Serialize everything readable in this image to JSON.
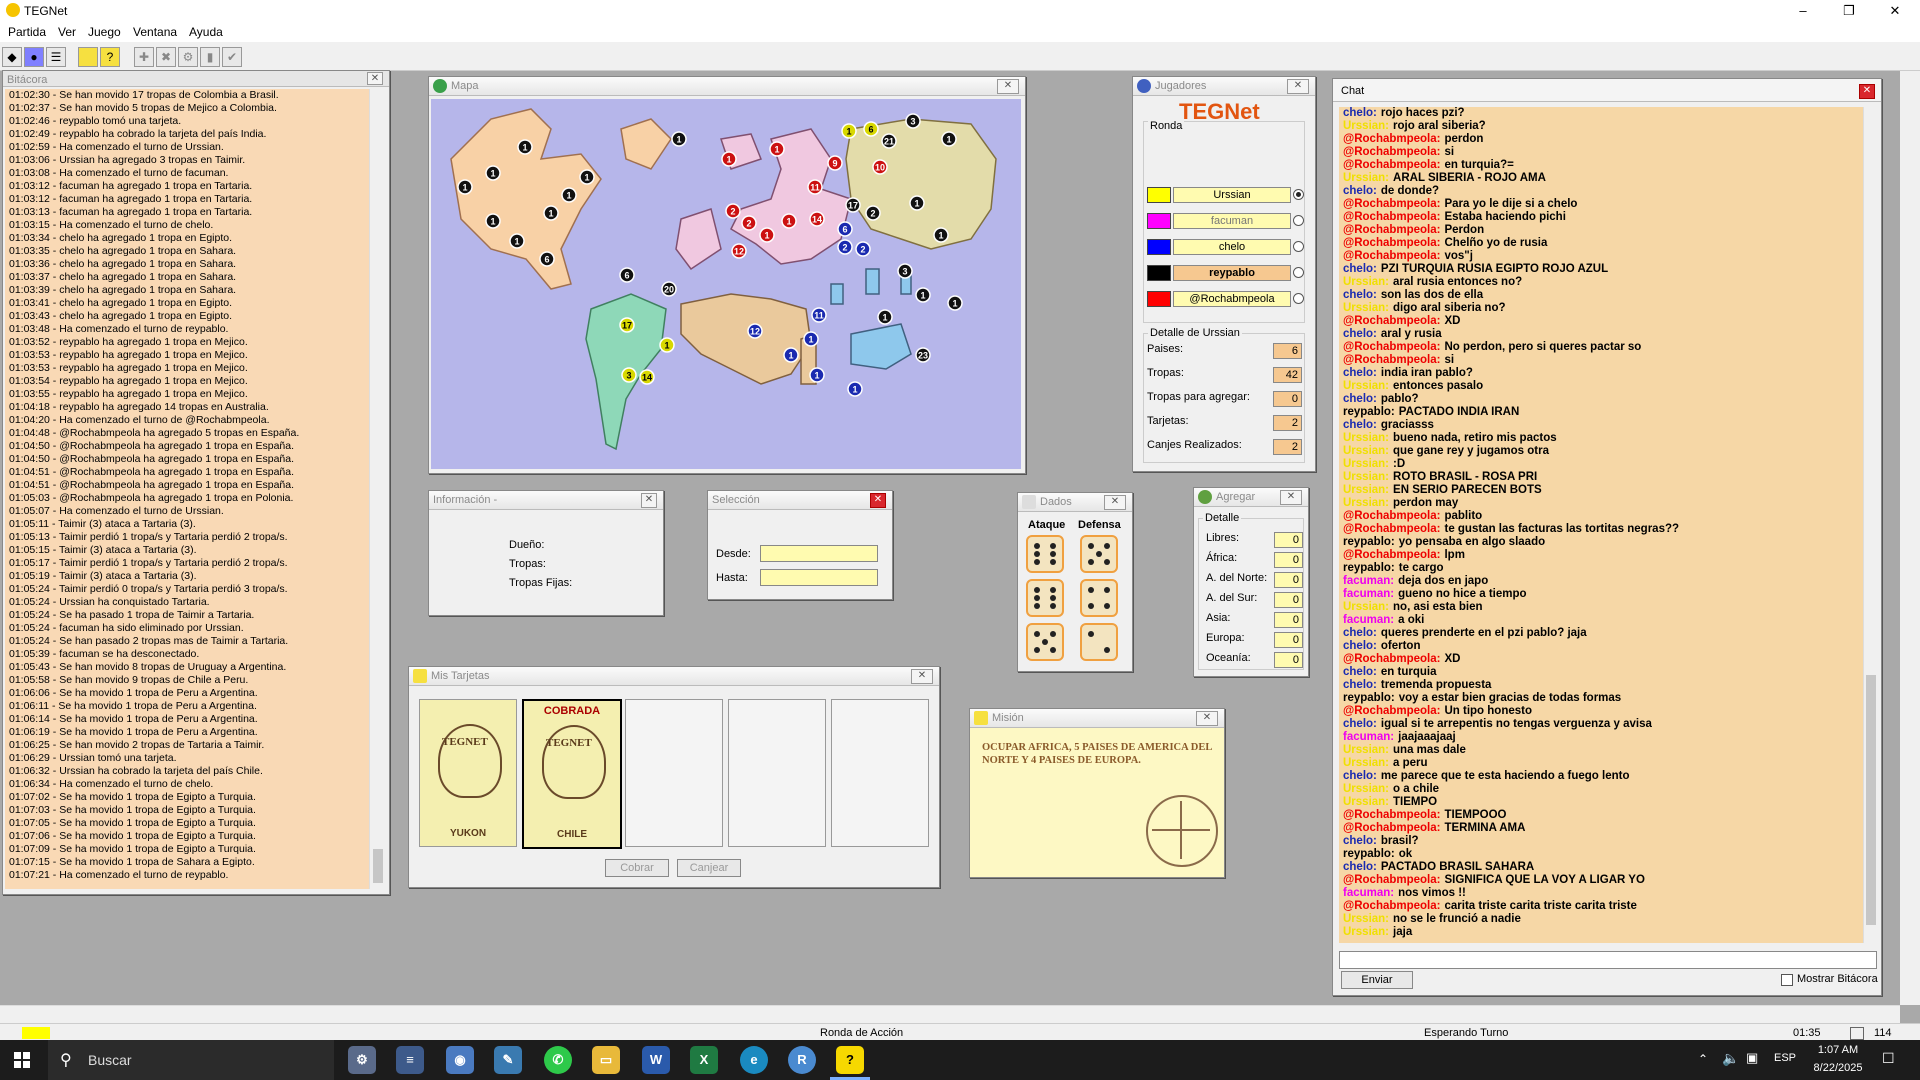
{
  "window": {
    "title": "TEGNet"
  },
  "menu": [
    "Partida",
    "Ver",
    "Juego",
    "Ventana",
    "Ayuda"
  ],
  "bitacora": {
    "title": "Bitácora",
    "lines": [
      "01:02:30 - Se han movido 17 tropas de Colombia a Brasil.",
      "01:02:37 - Se han movido 5 tropas de Mejico a Colombia.",
      "01:02:46 - reypablo tomó una tarjeta.",
      "01:02:49 - reypablo ha cobrado la tarjeta del país India.",
      "01:02:59 - Ha comenzado el turno de Urssian.",
      "01:03:06 - Urssian ha agregado 3 tropas en Taimir.",
      "01:03:08 - Ha comenzado el turno de facuman.",
      "01:03:12 - facuman ha agregado 1 tropa en Tartaria.",
      "01:03:12 - facuman ha agregado 1 tropa en Tartaria.",
      "01:03:13 - facuman ha agregado 1 tropa en Tartaria.",
      "01:03:15 - Ha comenzado el turno de chelo.",
      "01:03:34 - chelo ha agregado 1 tropa en Egipto.",
      "01:03:35 - chelo ha agregado 1 tropa en Sahara.",
      "01:03:36 - chelo ha agregado 1 tropa en Sahara.",
      "01:03:37 - chelo ha agregado 1 tropa en Sahara.",
      "01:03:39 - chelo ha agregado 1 tropa en Sahara.",
      "01:03:41 - chelo ha agregado 1 tropa en Egipto.",
      "01:03:43 - chelo ha agregado 1 tropa en Egipto.",
      "01:03:48 - Ha comenzado el turno de reypablo.",
      "01:03:52 - reypablo ha agregado 1 tropa en Mejico.",
      "01:03:53 - reypablo ha agregado 1 tropa en Mejico.",
      "01:03:53 - reypablo ha agregado 1 tropa en Mejico.",
      "01:03:54 - reypablo ha agregado 1 tropa en Mejico.",
      "01:03:55 - reypablo ha agregado 1 tropa en Mejico.",
      "01:04:18 - reypablo ha agregado 14 tropas en Australia.",
      "01:04:20 - Ha comenzado el turno de @Rochabmpeola.",
      "01:04:48 - @Rochabmpeola ha agregado 5 tropas en España.",
      "01:04:50 - @Rochabmpeola ha agregado 1 tropa en España.",
      "01:04:50 - @Rochabmpeola ha agregado 1 tropa en España.",
      "01:04:51 - @Rochabmpeola ha agregado 1 tropa en España.",
      "01:04:51 - @Rochabmpeola ha agregado 1 tropa en España.",
      "01:05:03 - @Rochabmpeola ha agregado 1 tropa en Polonia.",
      "01:05:07 - Ha comenzado el turno de Urssian.",
      "01:05:11 - Taimir (3) ataca a Tartaria (3).",
      "01:05:13 - Taimir perdió 1 tropa/s y Tartaria perdió 2 tropa/s.",
      "01:05:15 - Taimir (3) ataca a Tartaria (3).",
      "01:05:17 - Taimir perdió 1 tropa/s y Tartaria perdió 2 tropa/s.",
      "01:05:19 - Taimir (3) ataca a Tartaria (3).",
      "01:05:24 - Taimir perdió 0 tropa/s y Tartaria perdió 3 tropa/s.",
      "01:05:24 - Urssian ha conquistado Tartaria.",
      "01:05:24 - Se ha pasado 1 tropa de Taimir a Tartaria.",
      "01:05:24 - facuman ha sido eliminado por Urssian.",
      "01:05:24 - Se han pasado 2 tropas mas de Taimir a Tartaria.",
      "01:05:39 - facuman se ha desconectado.",
      "01:05:43 - Se han movido 8 tropas de Uruguay a Argentina.",
      "01:05:58 - Se han movido 9 tropas de Chile a Peru.",
      "01:06:06 - Se ha movido 1 tropa de Peru a Argentina.",
      "01:06:11 - Se ha movido 1 tropa de Peru a Argentina.",
      "01:06:14 - Se ha movido 1 tropa de Peru a Argentina.",
      "01:06:19 - Se ha movido 1 tropa de Peru a Argentina.",
      "01:06:25 - Se han movido 2 tropas de Tartaria a Taimir.",
      "01:06:29 - Urssian tomó una tarjeta.",
      "01:06:32 - Urssian ha cobrado la tarjeta del país Chile.",
      "01:06:34 - Ha comenzado el turno de chelo.",
      "01:07:02 - Se ha movido 1 tropa de Egipto a Turquia.",
      "01:07:03 - Se ha movido 1 tropa de Egipto a Turquia.",
      "01:07:05 - Se ha movido 1 tropa de Egipto a Turquia.",
      "01:07:06 - Se ha movido 1 tropa de Egipto a Turquia.",
      "01:07:09 - Se ha movido 1 tropa de Egipto a Turquia.",
      "01:07:15 - Se ha movido 1 tropa de Sahara a Egipto.",
      "01:07:21 - Ha comenzado el turno de reypablo."
    ]
  },
  "mapa": {
    "title": "Mapa",
    "colors": {
      "sea": "#b6b6ea",
      "orange": "#f8d1a6",
      "yellow": "#e3dcaa",
      "pink": "#f0c8e0",
      "green": "#8ed8b8",
      "tan": "#eac99c",
      "blue": "#8ec8ec"
    },
    "armies": [
      {
        "n": "1",
        "c": "#111"
      },
      {
        "n": "1",
        "c": "#111"
      },
      {
        "n": "1",
        "c": "#111"
      },
      {
        "n": "1",
        "c": "#111"
      },
      {
        "n": "1",
        "c": "#111"
      },
      {
        "n": "1",
        "c": "#111"
      },
      {
        "n": "1",
        "c": "#111"
      },
      {
        "n": "1",
        "c": "#111"
      },
      {
        "n": "1",
        "c": "#111"
      },
      {
        "n": "6",
        "c": "#111"
      },
      {
        "n": "1",
        "c": "#cc1111"
      },
      {
        "n": "2",
        "c": "#cc1111"
      },
      {
        "n": "1",
        "c": "#cc1111"
      },
      {
        "n": "12",
        "c": "#cc1111"
      },
      {
        "n": "1",
        "c": "#cc1111"
      },
      {
        "n": "1",
        "c": "#cc1111"
      },
      {
        "n": "2",
        "c": "#cc1111"
      },
      {
        "n": "11",
        "c": "#cc1111"
      },
      {
        "n": "14",
        "c": "#cc1111"
      },
      {
        "n": "9",
        "c": "#cc1111"
      },
      {
        "n": "10",
        "c": "#cc1111"
      },
      {
        "n": "6",
        "c": "#1a2ab0"
      },
      {
        "n": "2",
        "c": "#1a2ab0"
      },
      {
        "n": "2",
        "c": "#1a2ab0"
      },
      {
        "n": "12",
        "c": "#1a2ab0"
      },
      {
        "n": "11",
        "c": "#1a2ab0"
      },
      {
        "n": "1",
        "c": "#1a2ab0"
      },
      {
        "n": "1",
        "c": "#1a2ab0"
      },
      {
        "n": "1",
        "c": "#1a2ab0"
      },
      {
        "n": "1",
        "c": "#1a2ab0"
      },
      {
        "n": "1",
        "c": "#d8d800"
      },
      {
        "n": "6",
        "c": "#d8d800"
      },
      {
        "n": "17",
        "c": "#d8d800"
      },
      {
        "n": "1",
        "c": "#d8d800"
      },
      {
        "n": "3",
        "c": "#d8d800"
      },
      {
        "n": "14",
        "c": "#d8d800"
      },
      {
        "n": "3",
        "c": "#111"
      },
      {
        "n": "21",
        "c": "#111"
      },
      {
        "n": "1",
        "c": "#111"
      },
      {
        "n": "1",
        "c": "#111"
      },
      {
        "n": "2",
        "c": "#111"
      },
      {
        "n": "17",
        "c": "#111"
      },
      {
        "n": "1",
        "c": "#111"
      },
      {
        "n": "3",
        "c": "#111"
      },
      {
        "n": "6",
        "c": "#111"
      },
      {
        "n": "20",
        "c": "#111"
      },
      {
        "n": "1",
        "c": "#111"
      },
      {
        "n": "1",
        "c": "#111"
      },
      {
        "n": "1",
        "c": "#111"
      },
      {
        "n": "23",
        "c": "#111"
      }
    ]
  },
  "jugadores": {
    "title": "Jugadores",
    "logo": "TEGNet",
    "ronda_label": "Ronda",
    "players": [
      {
        "name": "Urssian",
        "color": "#ffff00",
        "selected": true
      },
      {
        "name": "facuman",
        "color": "#ff00ff",
        "selected": false
      },
      {
        "name": "chelo",
        "color": "#0000ff",
        "selected": false
      },
      {
        "name": "reypablo",
        "color": "#000000",
        "selected": false
      },
      {
        "name": "@Rochabmpeola",
        "color": "#ff0000",
        "selected": false
      }
    ],
    "detalle_title": "Detalle de Urssian",
    "detalle": [
      {
        "label": "Paises:",
        "value": "6"
      },
      {
        "label": "Tropas:",
        "value": "42"
      },
      {
        "label": "Tropas para agregar:",
        "value": "0"
      },
      {
        "label": "Tarjetas:",
        "value": "2"
      },
      {
        "label": "Canjes Realizados:",
        "value": "2"
      }
    ]
  },
  "informacion": {
    "title": "Información -",
    "duenio": "Dueño:",
    "tropas": "Tropas:",
    "tropas_fijas": "Tropas Fijas:"
  },
  "seleccion": {
    "title": "Selección",
    "desde": "Desde:",
    "hasta": "Hasta:"
  },
  "dados": {
    "title": "Dados",
    "ataque": "Ataque",
    "defensa": "Defensa",
    "attack_values": [
      6,
      6,
      5
    ],
    "defense_values": [
      5,
      4,
      2
    ]
  },
  "agregar": {
    "title": "Agregar",
    "detalle": "Detalle",
    "rows": [
      {
        "label": "Libres:",
        "value": "0"
      },
      {
        "label": "África:",
        "value": "0"
      },
      {
        "label": "A. del Norte:",
        "value": "0"
      },
      {
        "label": "A. del Sur:",
        "value": "0"
      },
      {
        "label": "Asia:",
        "value": "0"
      },
      {
        "label": "Europa:",
        "value": "0"
      },
      {
        "label": "Oceanía:",
        "value": "0"
      }
    ]
  },
  "tarjetas": {
    "title": "Mis Tarjetas",
    "card_brand": "TEGNET",
    "cards": [
      {
        "name": "YUKON",
        "status": ""
      },
      {
        "name": "CHILE",
        "status": "COBRADA"
      }
    ],
    "cobrar": "Cobrar",
    "canjear": "Canjear"
  },
  "mision": {
    "title": "Misión",
    "text": "OCUPAR AFRICA, 5 PAISES DE AMERICA DEL NORTE Y 4 PAISES DE EUROPA."
  },
  "chat": {
    "title": "Chat",
    "enviar": "Enviar",
    "mostrar": "Mostrar Bitácora",
    "name_colors": {
      "chelo": "#1a2ab0",
      "Urssian": "#f0e000",
      "@Rochabmpeola": "#ee0000",
      "reypablo": "#000000",
      "facuman": "#ee00ee"
    },
    "messages": [
      {
        "u": "chelo",
        "m": "rojo haces pzi?"
      },
      {
        "u": "Urssian",
        "m": "rojo aral siberia?"
      },
      {
        "u": "@Rochabmpeola",
        "m": "perdon"
      },
      {
        "u": "@Rochabmpeola",
        "m": "si"
      },
      {
        "u": "@Rochabmpeola",
        "m": "en turquia?="
      },
      {
        "u": "Urssian",
        "m": "ARAL SIBERIA - ROJO AMA"
      },
      {
        "u": "chelo",
        "m": "de donde?"
      },
      {
        "u": "@Rochabmpeola",
        "m": "Para yo le dije si a chelo"
      },
      {
        "u": "@Rochabmpeola",
        "m": "Estaba haciendo pichi"
      },
      {
        "u": "@Rochabmpeola",
        "m": "Perdon"
      },
      {
        "u": "@Rochabmpeola",
        "m": "Chelño yo de rusia"
      },
      {
        "u": "@Rochabmpeola",
        "m": "vos\"j"
      },
      {
        "u": "chelo",
        "m": "PZI TURQUIA RUSIA EGIPTO ROJO AZUL"
      },
      {
        "u": "Urssian",
        "m": "aral rusia entonces no?"
      },
      {
        "u": "chelo",
        "m": "son las dos de ella"
      },
      {
        "u": "Urssian",
        "m": "digo aral siberia no?"
      },
      {
        "u": "@Rochabmpeola",
        "m": "XD"
      },
      {
        "u": "chelo",
        "m": "aral y rusia"
      },
      {
        "u": "@Rochabmpeola",
        "m": "No perdon, pero si queres pactar so"
      },
      {
        "u": "@Rochabmpeola",
        "m": "si"
      },
      {
        "u": "chelo",
        "m": "india iran pablo?"
      },
      {
        "u": "Urssian",
        "m": "entonces pasalo"
      },
      {
        "u": "chelo",
        "m": "pablo?"
      },
      {
        "u": "reypablo",
        "m": "PACTADO INDIA IRAN"
      },
      {
        "u": "chelo",
        "m": "graciasss"
      },
      {
        "u": "Urssian",
        "m": "bueno nada, retiro mis pactos"
      },
      {
        "u": "Urssian",
        "m": "que gane rey y jugamos otra"
      },
      {
        "u": "Urssian",
        "m": ":D"
      },
      {
        "u": "Urssian",
        "m": "ROTO BRASIL - ROSA PRI"
      },
      {
        "u": "Urssian",
        "m": "EN SERIO PARECEN BOTS"
      },
      {
        "u": "Urssian",
        "m": "perdon may"
      },
      {
        "u": "@Rochabmpeola",
        "m": "pablito"
      },
      {
        "u": "@Rochabmpeola",
        "m": "te gustan las facturas las tortitas negras??"
      },
      {
        "u": "reypablo",
        "m": "yo pensaba en algo slaado"
      },
      {
        "u": "@Rochabmpeola",
        "m": "lpm"
      },
      {
        "u": "reypablo",
        "m": "te cargo"
      },
      {
        "u": "facuman",
        "m": "deja dos en japo"
      },
      {
        "u": "facuman",
        "m": "gueno no hice a tiempo"
      },
      {
        "u": "Urssian",
        "m": "no, asi esta bien"
      },
      {
        "u": "facuman",
        "m": "a oki"
      },
      {
        "u": "chelo",
        "m": "queres prenderte en el pzi pablo? jaja"
      },
      {
        "u": "chelo",
        "m": "oferton"
      },
      {
        "u": "@Rochabmpeola",
        "m": "XD"
      },
      {
        "u": "chelo",
        "m": "en turquia"
      },
      {
        "u": "chelo",
        "m": "tremenda propuesta"
      },
      {
        "u": "reypablo",
        "m": "voy a  estar bien gracias de todas formas"
      },
      {
        "u": "@Rochabmpeola",
        "m": "Un tipo honesto"
      },
      {
        "u": "chelo",
        "m": "igual si te arrepentis no tengas verguenza y avisa"
      },
      {
        "u": "facuman",
        "m": "jaajaaajaaj"
      },
      {
        "u": "Urssian",
        "m": "una mas dale"
      },
      {
        "u": "Urssian",
        "m": "a peru"
      },
      {
        "u": "chelo",
        "m": "me parece que te esta haciendo a fuego lento"
      },
      {
        "u": "Urssian",
        "m": "o a chile"
      },
      {
        "u": "Urssian",
        "m": "TIEMPO"
      },
      {
        "u": "@Rochabmpeola",
        "m": "TIEMPOOO"
      },
      {
        "u": "@Rochabmpeola",
        "m": "TERMINA AMA"
      },
      {
        "u": "chelo",
        "m": "brasil?"
      },
      {
        "u": "reypablo",
        "m": "ok"
      },
      {
        "u": "chelo",
        "m": "PACTADO BRASIL SAHARA"
      },
      {
        "u": "@Rochabmpeola",
        "m": "SIGNIFICA QUE LA VOY A LIGAR YO"
      },
      {
        "u": "facuman",
        "m": "nos vimos !!"
      },
      {
        "u": "@Rochabmpeola",
        "m": "carita triste carita triste carita triste"
      },
      {
        "u": "Urssian",
        "m": "no se le frunció a nadie"
      },
      {
        "u": "Urssian",
        "m": "jaja"
      }
    ]
  },
  "status": {
    "ronda": "Ronda de Acción",
    "esperando": "Esperando Turno",
    "time": "01:35",
    "count": "114"
  },
  "taskbar": {
    "search": "Buscar",
    "lang": "ESP",
    "clock_time": "1:07 AM",
    "clock_date": "8/22/2025"
  }
}
